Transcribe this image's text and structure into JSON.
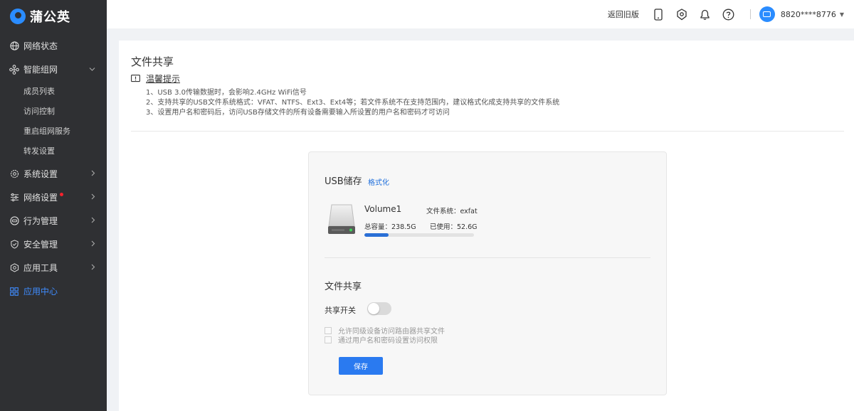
{
  "app": {
    "logo_text": "蒲公英",
    "brand_color": "#2a8cff"
  },
  "sidebar": {
    "items": [
      {
        "label": "网络状态",
        "icon": "globe-icon"
      },
      {
        "label": "智能组网",
        "icon": "network-icon",
        "expanded": true,
        "children": [
          {
            "label": "成员列表"
          },
          {
            "label": "访问控制"
          },
          {
            "label": "重启组网服务"
          },
          {
            "label": "转发设置"
          }
        ]
      },
      {
        "label": "系统设置",
        "icon": "gear-icon"
      },
      {
        "label": "网络设置",
        "icon": "sliders-icon",
        "badge": "red-dot"
      },
      {
        "label": "行为管理",
        "icon": "behavior-icon"
      },
      {
        "label": "安全管理",
        "icon": "shield-icon"
      },
      {
        "label": "应用工具",
        "icon": "tool-icon"
      },
      {
        "label": "应用中心",
        "icon": "apps-icon",
        "active": true
      }
    ]
  },
  "header": {
    "back_old": "返回旧版",
    "icons": [
      "phone-icon",
      "diagnostic-icon",
      "bell-icon",
      "help-icon"
    ],
    "account": "8820****8776"
  },
  "main": {
    "title": "文件共享",
    "tips_title": "温馨提示",
    "tips": [
      "1、USB 3.0传输数据时，会影响2.4GHz WiFi信号",
      "2、支持共享的USB文件系统格式：VFAT、NTFS、Ext3、Ext4等；若文件系统不在支持范围内，建议格式化成支持共享的文件系统",
      "3、设置用户名和密码后，访问USB存储文件的所有设备需要输入所设置的用户名和密码才可访问"
    ]
  },
  "usb": {
    "title": "USB储存",
    "format_link": "格式化",
    "volume_name": "Volume1",
    "filesystem_label": "文件系统：exfat",
    "capacity_label": "总容量：238.5G",
    "used_label": "已使用：52.6G",
    "usage_fraction": 0.22
  },
  "share": {
    "title": "文件共享",
    "switch_label": "共享开关",
    "switch_on": false,
    "options": [
      "允许同级设备访问路由器共享文件",
      "通过用户名和密码设置访问权限"
    ],
    "save_label": "保存"
  }
}
